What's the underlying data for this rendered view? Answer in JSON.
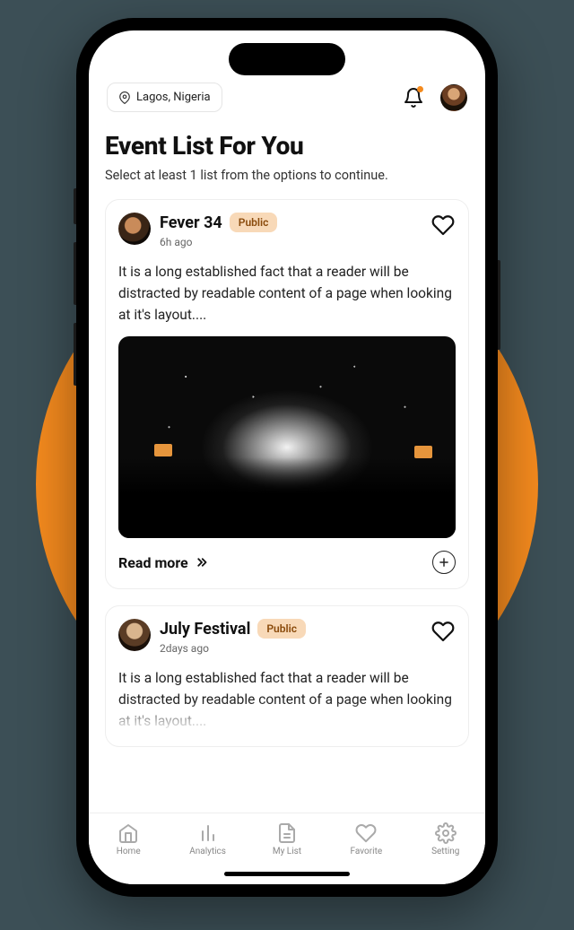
{
  "header": {
    "location": "Lagos, Nigeria"
  },
  "page": {
    "title": "Event List For You",
    "subtitle": "Select at least 1 list from the options to continue."
  },
  "events": [
    {
      "name": "Fever 34",
      "badge": "Public",
      "time_ago": "6h ago",
      "description": "It is a long established fact that a reader will be distracted by readable content of a page when looking at it's layout....",
      "read_more_label": "Read more"
    },
    {
      "name": "July Festival",
      "badge": "Public",
      "time_ago": "2days ago",
      "description": "It is a long established fact that a reader will be distracted by readable content of a page when looking at it's layout...."
    }
  ],
  "tabs": {
    "home": "Home",
    "analytics": "Analytics",
    "mylist": "My List",
    "favorite": "Favorite",
    "setting": "Setting"
  }
}
